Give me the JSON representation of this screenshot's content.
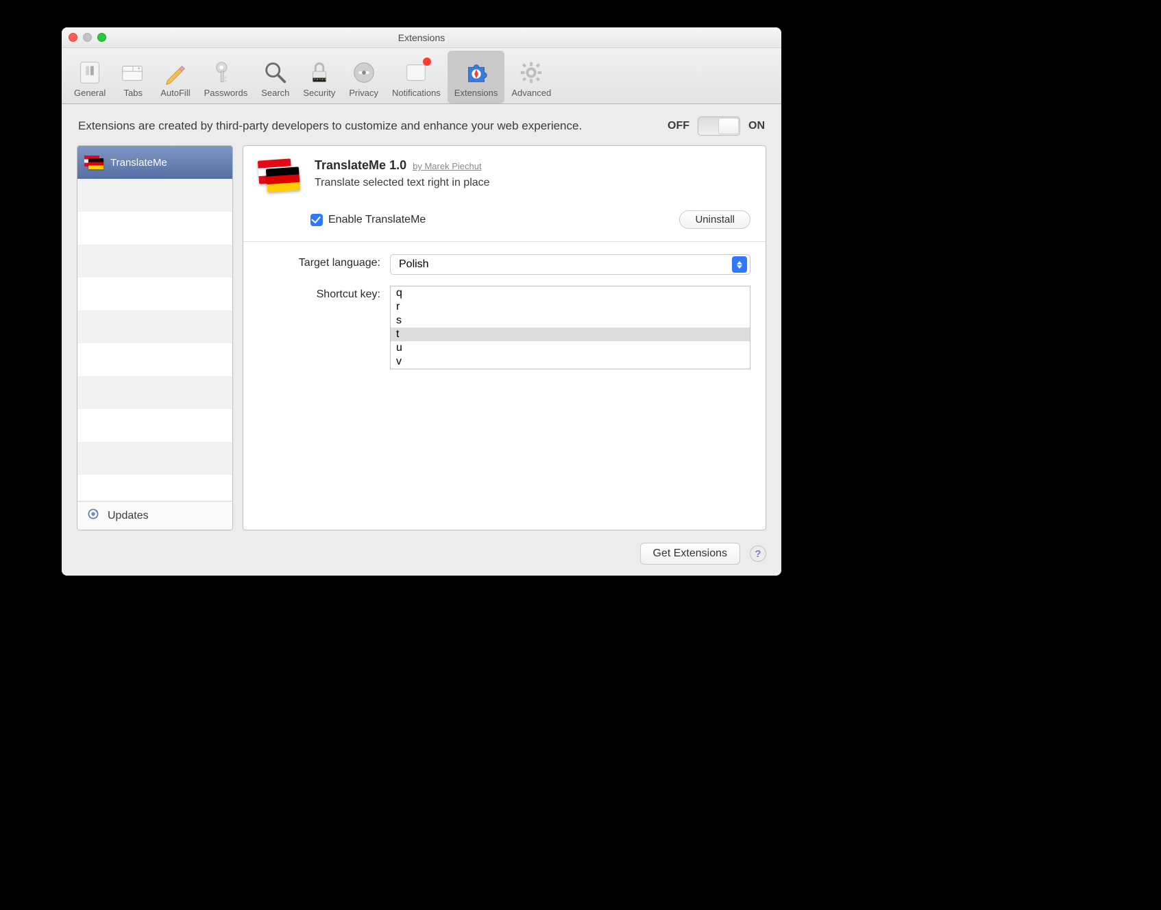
{
  "window": {
    "title": "Extensions"
  },
  "toolbar": {
    "items": [
      {
        "label": "General"
      },
      {
        "label": "Tabs"
      },
      {
        "label": "AutoFill"
      },
      {
        "label": "Passwords"
      },
      {
        "label": "Search"
      },
      {
        "label": "Security"
      },
      {
        "label": "Privacy"
      },
      {
        "label": "Notifications"
      },
      {
        "label": "Extensions"
      },
      {
        "label": "Advanced"
      }
    ]
  },
  "intro": "Extensions are created by third-party developers to customize and enhance your web experience.",
  "master_toggle": {
    "off_label": "OFF",
    "on_label": "ON",
    "state": "on"
  },
  "sidebar": {
    "items": [
      {
        "name": "TranslateMe",
        "selected": true
      }
    ],
    "updates_label": "Updates"
  },
  "detail": {
    "name": "TranslateMe",
    "version": "1.0",
    "author_prefix": "by",
    "author": "Marek Piechut",
    "description": "Translate selected text right in place",
    "enable_label": "Enable TranslateMe",
    "enabled": true,
    "uninstall_label": "Uninstall",
    "settings": {
      "target_language_label": "Target language:",
      "target_language_value": "Polish",
      "shortcut_key_label": "Shortcut key:",
      "shortcut_key_options": [
        "q",
        "r",
        "s",
        "t",
        "u",
        "v"
      ],
      "shortcut_key_selected": "t"
    }
  },
  "footer": {
    "get_extensions_label": "Get Extensions"
  }
}
